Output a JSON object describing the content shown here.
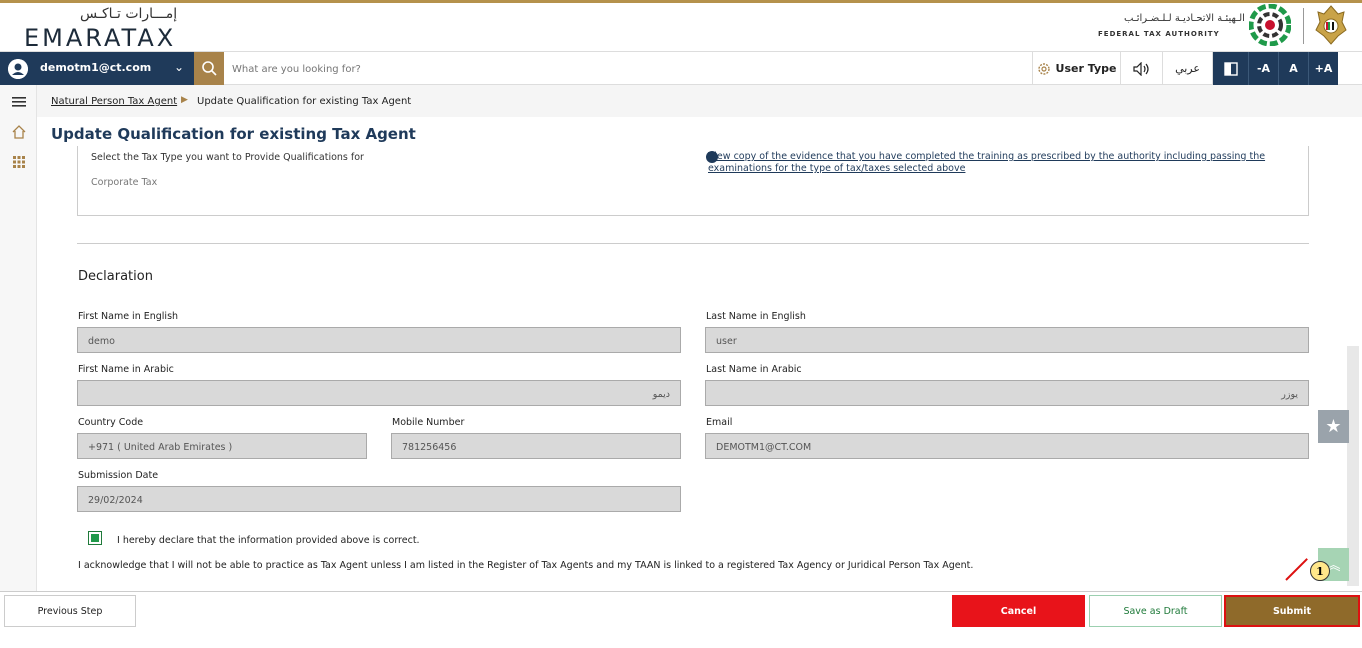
{
  "header": {
    "brand_arabic": "إمـــارات تـاكـس",
    "brand_english": "EMARATAX",
    "authority_arabic": "الـهيئـة الاتحـاديـة لـلـضـرائـب",
    "authority_english": "FEDERAL TAX AUTHORITY"
  },
  "navbar": {
    "user_email": "demotm1@ct.com",
    "search_placeholder": "What are you looking for?",
    "user_type_label": "User Type",
    "language_label": "عربي",
    "font_decrease": "-A",
    "font_normal": "A",
    "font_increase": "+A"
  },
  "breadcrumb": {
    "parent": "Natural Person Tax Agent",
    "current": "Update Qualification for existing Tax Agent"
  },
  "page_title": "Update Qualification for existing Tax Agent",
  "tax_type": {
    "label": "Select the Tax Type you want to Provide Qualifications for",
    "value": "Corporate Tax",
    "evidence_link": "View copy of the evidence that you have completed the training as prescribed by the authority including passing the examinations for the type of tax/taxes selected above"
  },
  "declaration": {
    "title": "Declaration",
    "first_name_en_label": "First Name in English",
    "first_name_en_value": "demo",
    "last_name_en_label": "Last Name in English",
    "last_name_en_value": "user",
    "first_name_ar_label": "First Name in Arabic",
    "first_name_ar_value": "ديمو",
    "last_name_ar_label": "Last Name in Arabic",
    "last_name_ar_value": "يوزر",
    "country_code_label": "Country Code",
    "country_code_value": "+971 ( United Arab Emirates )",
    "mobile_label": "Mobile Number",
    "mobile_value": "781256456",
    "email_label": "Email",
    "email_value": "DEMOTM1@CT.COM",
    "submission_date_label": "Submission Date",
    "submission_date_value": "29/02/2024",
    "declare_checkbox_checked": true,
    "declare_text": "I hereby declare that the information provided above is correct.",
    "acknowledge_text": "I acknowledge that I will not be able to practice as Tax Agent unless I am listed in the Register of Tax Agents and my TAAN is linked to a registered Tax Agency or Juridical Person Tax Agent."
  },
  "footer": {
    "previous_label": "Previous Step",
    "cancel_label": "Cancel",
    "draft_label": "Save as Draft",
    "submit_label": "Submit"
  },
  "callout_number": "1",
  "colors": {
    "navy": "#1f3a5a",
    "gold": "#a8834a",
    "cancel_red": "#e8131a",
    "submit_brown": "#8f6a2a",
    "check_green": "#1f9a4a"
  }
}
